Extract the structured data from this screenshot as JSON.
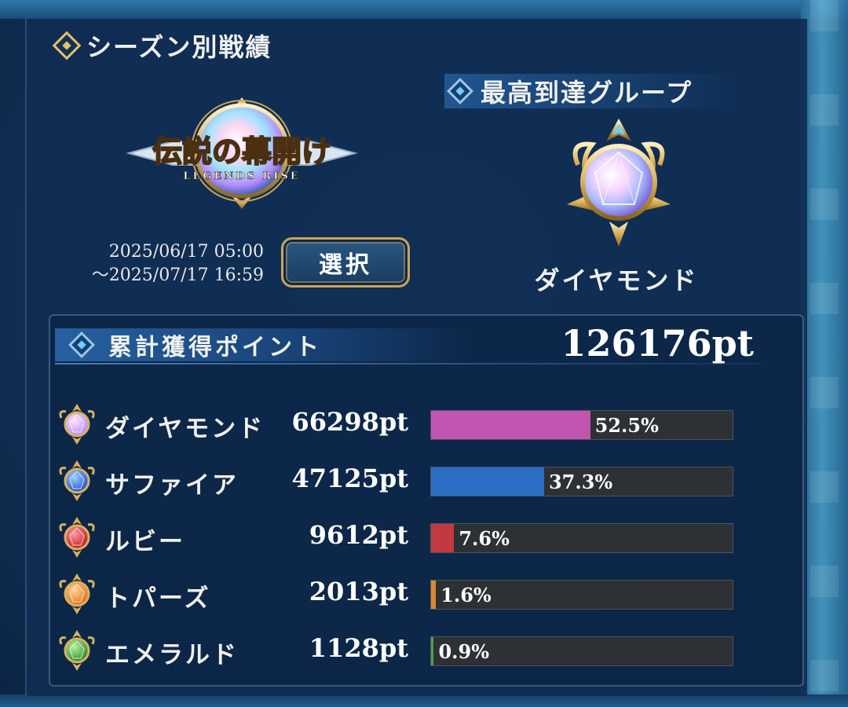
{
  "header": {
    "title": "シーズン別戦績"
  },
  "season": {
    "logo_title": "伝説の幕開け",
    "logo_subtitle": "LEGENDS RISE",
    "date_start": "2025/06/17 05:00",
    "date_end": "～2025/07/17 16:59",
    "select_label": "選択"
  },
  "best_group": {
    "title": "最高到達グループ",
    "name": "ダイヤモンド",
    "emblem_icon": "diamond-rank-emblem"
  },
  "points": {
    "label": "累計獲得ポイント",
    "total": "126176pt",
    "rows": [
      {
        "name": "ダイヤモンド",
        "points": "66298pt",
        "percent_label": "52.5%",
        "percent": 52.5,
        "color": "#c255b0",
        "icon": "diamond-gem-icon"
      },
      {
        "name": "サファイア",
        "points": "47125pt",
        "percent_label": "37.3%",
        "percent": 37.3,
        "color": "#2b6fc4",
        "icon": "sapphire-gem-icon"
      },
      {
        "name": "ルビー",
        "points": "9612pt",
        "percent_label": "7.6%",
        "percent": 7.6,
        "color": "#c23a3f",
        "icon": "ruby-gem-icon"
      },
      {
        "name": "トパーズ",
        "points": "2013pt",
        "percent_label": "1.6%",
        "percent": 1.6,
        "color": "#d98a2e",
        "icon": "topaz-gem-icon"
      },
      {
        "name": "エメラルド",
        "points": "1128pt",
        "percent_label": "0.9%",
        "percent": 0.9,
        "color": "#4aa24a",
        "icon": "emerald-gem-icon"
      }
    ]
  }
}
